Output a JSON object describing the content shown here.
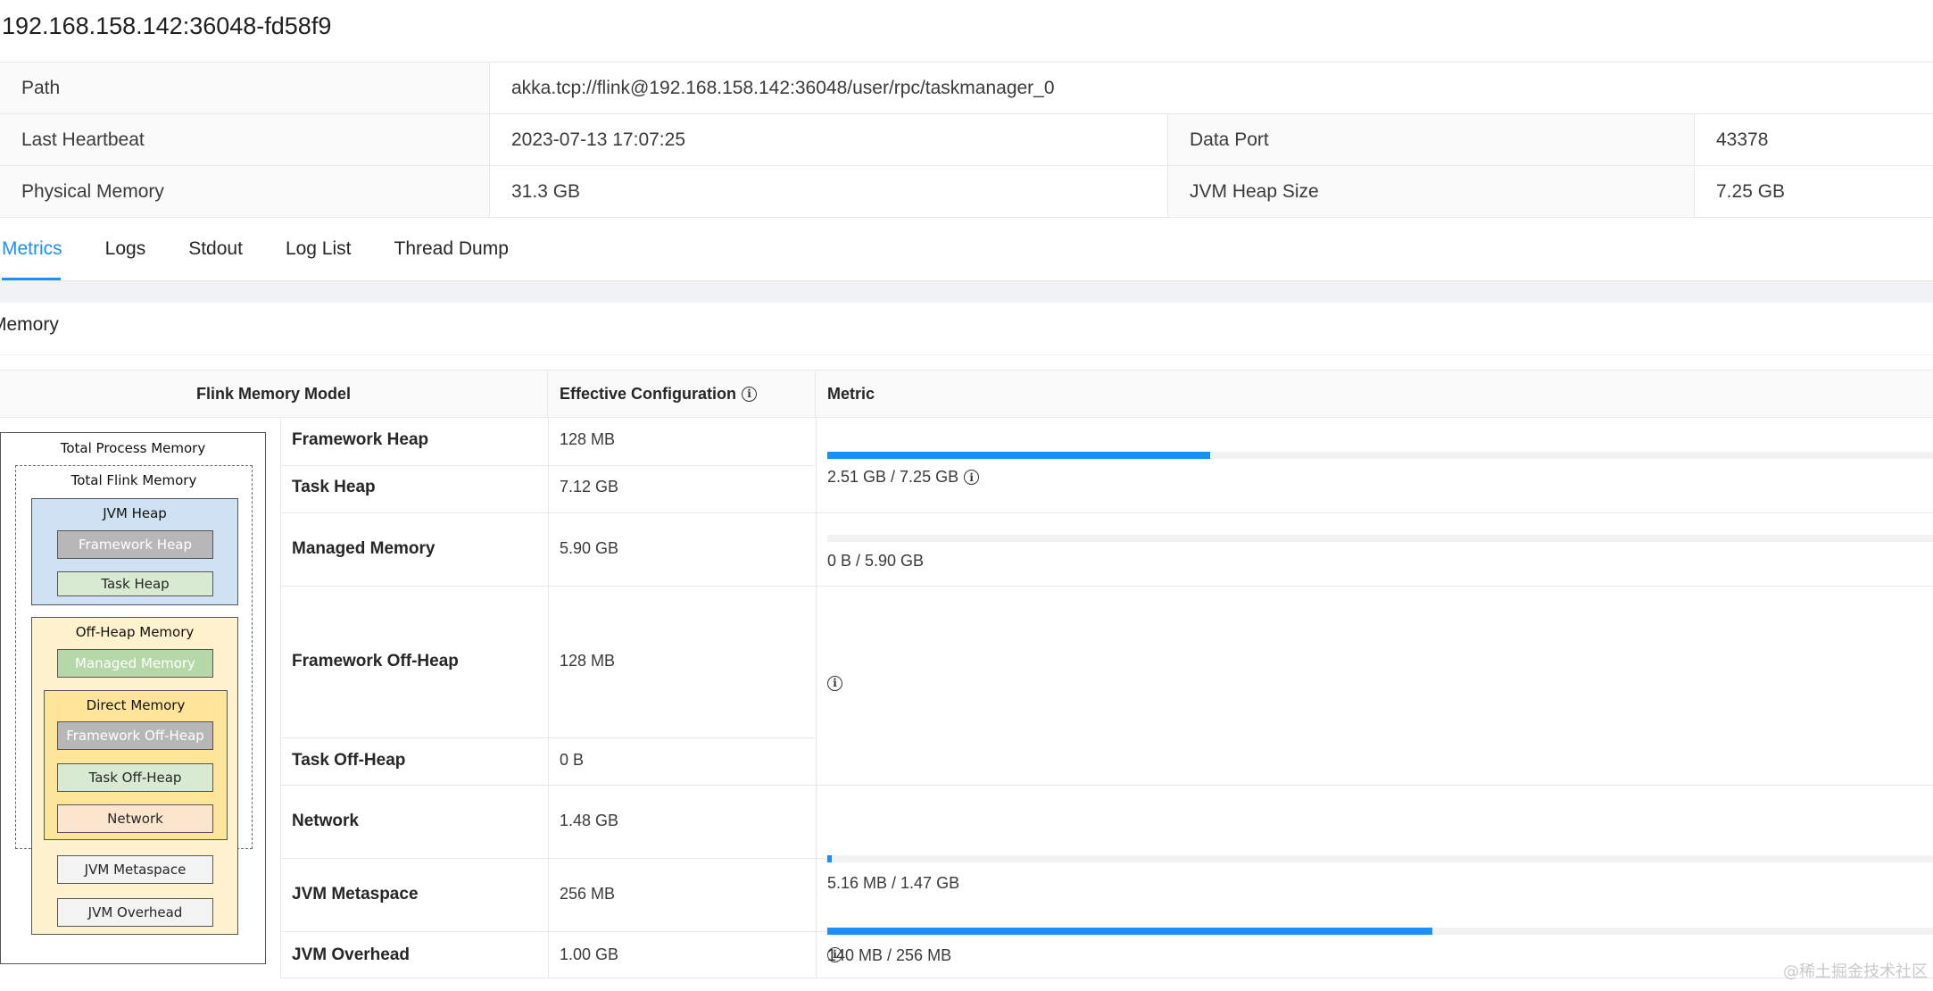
{
  "header": {
    "title": "192.168.158.142:36048-fd58f9"
  },
  "info": {
    "path_label": "Path",
    "path_value": "akka.tcp://flink@192.168.158.142:36048/user/rpc/taskmanager_0",
    "heartbeat_label": "Last Heartbeat",
    "heartbeat_value": "2023-07-13 17:07:25",
    "data_port_label": "Data Port",
    "data_port_value": "43378",
    "physical_memory_label": "Physical Memory",
    "physical_memory_value": "31.3 GB",
    "jvm_heap_label": "JVM Heap Size",
    "jvm_heap_value": "7.25 GB"
  },
  "tabs": [
    {
      "label": "Metrics",
      "active": true
    },
    {
      "label": "Logs",
      "active": false
    },
    {
      "label": "Stdout",
      "active": false
    },
    {
      "label": "Log List",
      "active": false
    },
    {
      "label": "Thread Dump",
      "active": false
    }
  ],
  "memory": {
    "card_title": "Memory",
    "headers": {
      "model": "Flink Memory Model",
      "effective": "Effective Configuration",
      "metric": "Metric"
    },
    "rows": [
      {
        "name": "Framework Heap",
        "value": "128 MB"
      },
      {
        "name": "Task Heap",
        "value": "7.12 GB"
      },
      {
        "name": "Managed Memory",
        "value": "5.90 GB"
      },
      {
        "name": "Framework Off-Heap",
        "value": "128 MB"
      },
      {
        "name": "Task Off-Heap",
        "value": "0 B"
      },
      {
        "name": "Network",
        "value": "1.48 GB"
      },
      {
        "name": "JVM Metaspace",
        "value": "256 MB"
      },
      {
        "name": "JVM Overhead",
        "value": "1.00 GB"
      }
    ],
    "metrics": {
      "heap": {
        "text": "2.51 GB / 7.25 GB",
        "fraction": 0.346
      },
      "managed": {
        "text": "0 B / 5.90 GB",
        "fraction": 0.0
      },
      "network": {
        "text": "5.16 MB / 1.47 GB",
        "fraction": 0.0034
      },
      "metaspace": {
        "text": "140 MB / 256 MB",
        "fraction": 0.547
      }
    },
    "bar_color": "#1890ff"
  },
  "diagram": {
    "total_process": "Total Process Memory",
    "total_flink": "Total Flink Memory",
    "jvm_heap": "JVM Heap",
    "framework_heap": "Framework Heap",
    "task_heap": "Task Heap",
    "off_heap": "Off-Heap Memory",
    "managed_memory": "Managed Memory",
    "direct_memory": "Direct Memory",
    "framework_off_heap": "Framework Off-Heap",
    "task_off_heap": "Task Off-Heap",
    "network": "Network",
    "jvm_metaspace": "JVM Metaspace",
    "jvm_overhead": "JVM Overhead",
    "colors": {
      "jvm_heap_bg": "#cfe2f3",
      "off_heap_bg": "#fff2cc",
      "direct_bg": "#ffe599",
      "grey_item": "#b7b7b7",
      "green_item": "#d9ead3",
      "managed_item": "#b6d7a8",
      "network_item": "#fce5cd",
      "plain_item": "#f3f3f3"
    }
  },
  "watermark": "@稀土掘金技术社区"
}
